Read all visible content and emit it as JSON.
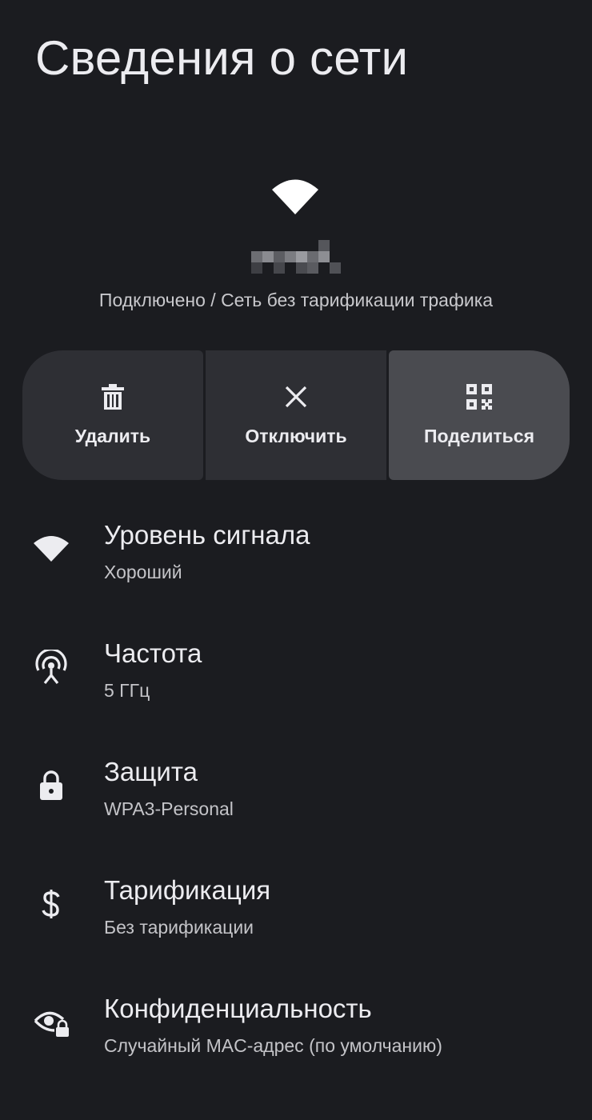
{
  "header": {
    "title": "Сведения о сети"
  },
  "network": {
    "icon": "wifi-icon",
    "status": "Подключено / Сеть без тарификации трафика"
  },
  "actions": [
    {
      "label": "Удалить",
      "icon": "trash-icon"
    },
    {
      "label": "Отключить",
      "icon": "close-icon"
    },
    {
      "label": "Поделиться",
      "icon": "qr-code-icon"
    }
  ],
  "details": [
    {
      "title": "Уровень сигнала",
      "value": "Хороший",
      "icon": "wifi-signal-icon"
    },
    {
      "title": "Частота",
      "value": "5 ГГц",
      "icon": "antenna-icon"
    },
    {
      "title": "Защита",
      "value": "WPA3-Personal",
      "icon": "lock-icon"
    },
    {
      "title": "Тарификация",
      "value": "Без тарификации",
      "icon": "dollar-icon"
    },
    {
      "title": "Конфиденциальность",
      "value": "Случайный MAC-адрес (по умолчанию)",
      "icon": "privacy-eye-icon"
    }
  ],
  "colors": {
    "background": "#1b1c20",
    "button": "#2e2f34",
    "button_active": "#4a4b50",
    "text_primary": "#ececf0",
    "text_secondary": "#c4c4c8"
  }
}
